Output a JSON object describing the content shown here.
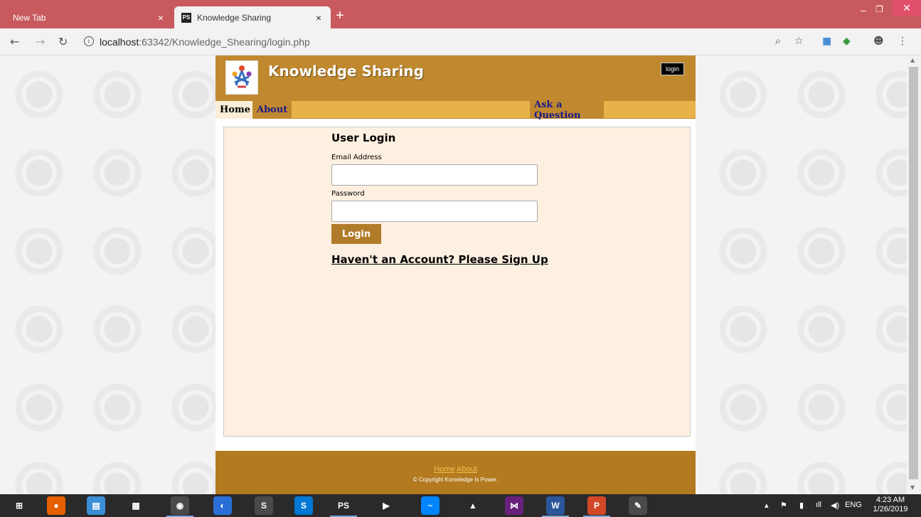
{
  "browser": {
    "tabs": [
      {
        "label": "New Tab",
        "active": false
      },
      {
        "label": "Knowledge Sharing",
        "active": true,
        "favicon": "PS"
      }
    ],
    "new_tab_glyph": "+",
    "close_glyph": "×",
    "url_host": "localhost",
    "url_rest": ":63342/Knowledge_Shearing/login.php",
    "info_glyph": "i"
  },
  "site": {
    "title": "Knowledge Sharing",
    "header_login": "login",
    "nav": {
      "home": "Home",
      "about": "About",
      "ask": "Ask a Question"
    },
    "login_form": {
      "title": "User Login",
      "email_label": "Email Address",
      "email_value": "",
      "password_label": "Password",
      "password_value": "",
      "submit": "Login",
      "signup_link": "Haven't an Account? Please Sign Up"
    },
    "footer": {
      "home": "Home",
      "about": "About",
      "copyright": "© Copyright Konwledge Is Power."
    }
  },
  "taskbar": {
    "apps": [
      {
        "name": "windows-start",
        "glyph": "⊞",
        "color": "#2a2a2a"
      },
      {
        "name": "firefox",
        "glyph": "●",
        "color": "#e66000"
      },
      {
        "name": "file-explorer",
        "glyph": "▤",
        "color": "#3a8fd6"
      },
      {
        "name": "app-grid",
        "glyph": "▦",
        "color": "#2a2a2a"
      },
      {
        "name": "chrome",
        "glyph": "◉",
        "color": "#4a4a4a"
      },
      {
        "name": "app-blue",
        "glyph": "◐",
        "color": "#2a6fd6"
      },
      {
        "name": "sublime",
        "glyph": "S",
        "color": "#4a4a4a"
      },
      {
        "name": "skype",
        "glyph": "S",
        "color": "#0078d4"
      },
      {
        "name": "phpstorm",
        "glyph": "PS",
        "color": "#2a2a2a"
      },
      {
        "name": "visual-studio-installer",
        "glyph": "▶",
        "color": "#2a2a2a"
      },
      {
        "name": "messenger",
        "glyph": "~",
        "color": "#0084ff"
      },
      {
        "name": "matlab",
        "glyph": "▲",
        "color": "#2a2a2a"
      },
      {
        "name": "visual-studio",
        "glyph": "⋈",
        "color": "#68217a"
      },
      {
        "name": "word",
        "glyph": "W",
        "color": "#2b579a"
      },
      {
        "name": "powerpoint",
        "glyph": "P",
        "color": "#d24726"
      },
      {
        "name": "paint",
        "glyph": "✎",
        "color": "#4a4a4a"
      }
    ],
    "tray": {
      "language": "ENG",
      "time": "4:23 AM",
      "date": "1/26/2019"
    }
  },
  "colors": {
    "tabstrip": "#c8595e",
    "header": "#c0892f",
    "navbar": "#e8b24a",
    "content": "#fdf0e0",
    "button": "#b17c2a",
    "footer": "#b37a20"
  }
}
